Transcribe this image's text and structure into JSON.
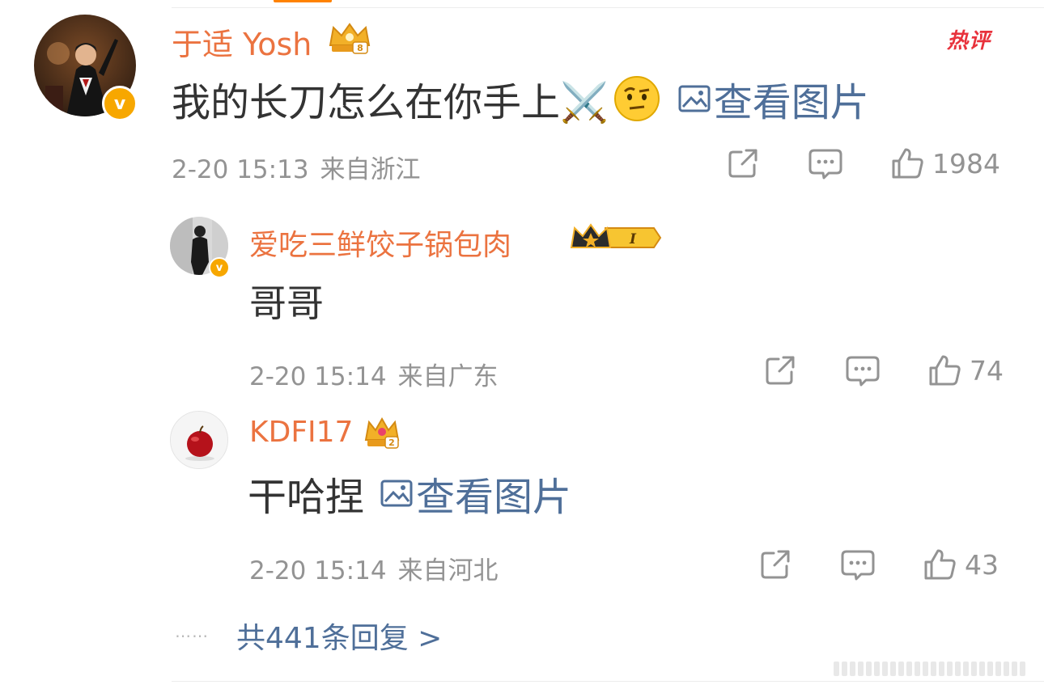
{
  "hot_label": "热评",
  "comments": [
    {
      "author": "于适 Yosh",
      "text": "我的长刀怎么在你手上⚔️",
      "view_image": "查看图片",
      "time": "2-20 15:13",
      "location": "来自浙江",
      "likes": "1984",
      "level": "8",
      "badge_color": "#f2b028"
    },
    {
      "author": "爱吃三鲜饺子锅包肉",
      "text": "哥哥",
      "time": "2-20 15:14",
      "location": "来自广东",
      "likes": "74",
      "level": "I",
      "badge_color": "#f7c531"
    },
    {
      "author": "KDFI17",
      "text": "干哈捏",
      "view_image": "查看图片",
      "time": "2-20 15:14",
      "location": "来自河北",
      "likes": "43",
      "level": "2",
      "badge_color": "#f2b028"
    }
  ],
  "more_replies": {
    "dots": "⋯⋯",
    "label": "共441条回复 >"
  },
  "icons": [
    "share-icon",
    "comment-icon",
    "like-icon",
    "image-icon",
    "verified-icon",
    "crown-icon",
    "swords-emoji",
    "raised-eyebrow-emoji"
  ],
  "colors": {
    "name": "#eb7340",
    "link": "#4f6f99",
    "meta": "#939393",
    "hot": "#e8323c",
    "verified": "#f7a700"
  }
}
